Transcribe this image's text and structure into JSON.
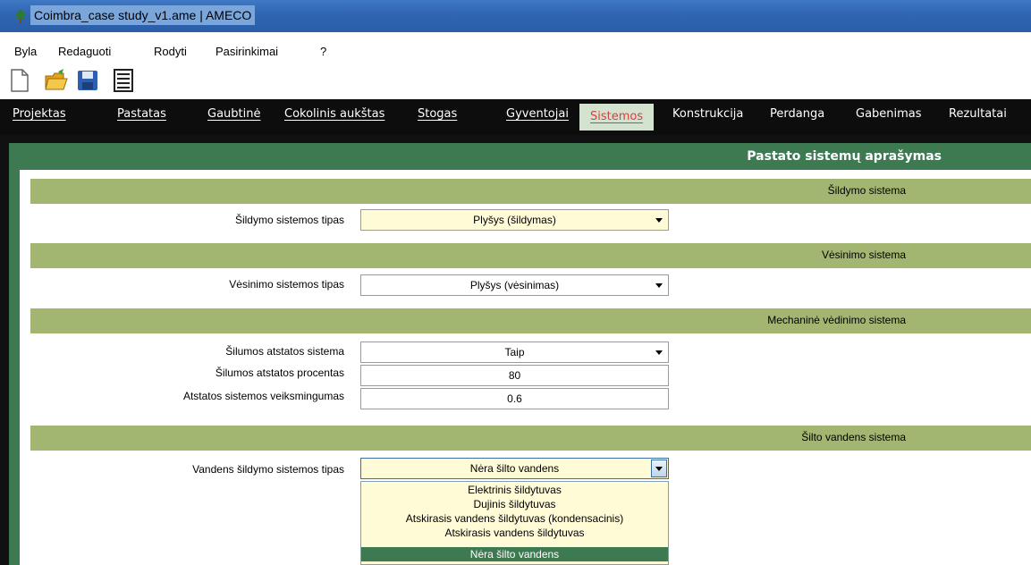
{
  "window": {
    "title": "Coimbra_case study_v1.ame | AMECO"
  },
  "menu": [
    "Byla",
    "Redaguoti",
    "Rodyti",
    "Pasirinkimai",
    "?"
  ],
  "toolbar": {
    "icons": [
      "new-file-icon",
      "open-folder-icon",
      "save-icon",
      "document-list-icon"
    ]
  },
  "tabs": [
    "Projektas",
    "Pastatas",
    "Gaubtinė",
    "Cokolinis aukštas",
    "Stogas",
    "Gyventojai",
    "Sistemos",
    "Konstrukcija",
    "Perdanga",
    "Gabenimas",
    "Rezultatai"
  ],
  "active_tab": "Sistemos",
  "panel": {
    "title": "Pastato sistemų aprašymas"
  },
  "sections": {
    "heating": {
      "header": "Šildymo sistema",
      "type_label": "Šildymo sistemos tipas",
      "type_value": "Plyšys (šildymas)"
    },
    "cooling": {
      "header": "Vėsinimo sistema",
      "type_label": "Vėsinimo sistemos tipas",
      "type_value": "Plyšys (vėsinimas)"
    },
    "ventilation": {
      "header": "Mechaninė vėdinimo sistema",
      "recovery_label": "Šilumos atstatos sistema",
      "recovery_value": "Taip",
      "percent_label": "Šilumos atstatos procentas",
      "percent_value": "80",
      "efficiency_label": "Atstatos sistemos veiksmingumas",
      "efficiency_value": "0.6"
    },
    "hot_water": {
      "header": "Šilto vandens sistema",
      "type_label": "Vandens šildymo sistemos tipas",
      "type_value": "Nėra šilto vandens",
      "options": [
        "Elektrinis šildytuvas",
        "Dujinis šildytuvas",
        "Atskirasis vandens šildytuvas (kondensacinis)",
        "Atskirasis vandens šildytuvas",
        "Nėra šilto vandens"
      ],
      "selected_option": "Nėra šilto vandens"
    }
  },
  "colors": {
    "accent_green": "#3d7a52",
    "section_olive": "#a2b571",
    "field_yellow": "#fffbd6",
    "active_tab_text": "#d94040"
  }
}
